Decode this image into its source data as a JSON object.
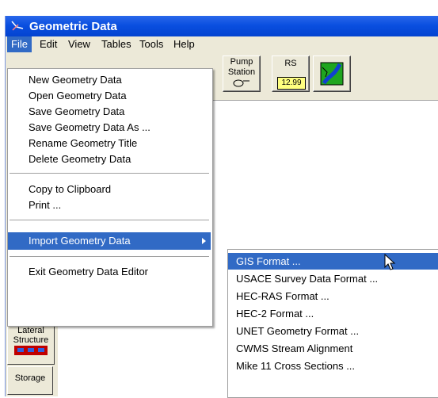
{
  "window": {
    "title": "Geometric Data"
  },
  "menubar": {
    "items": [
      "File",
      "Edit",
      "View",
      "Tables",
      "Tools",
      "Help"
    ]
  },
  "toolbar": {
    "pump_station_label_1": "Pump",
    "pump_station_label_2": "Station",
    "rs_label": "RS",
    "rs_value": "12.99"
  },
  "sidebar": {
    "lateral_structure_label_1": "Lateral",
    "lateral_structure_label_2": "Structure",
    "storage_label": "Storage"
  },
  "file_menu": {
    "new_geometry": "New Geometry Data",
    "open_geometry": "Open Geometry Data",
    "save_geometry": "Save Geometry Data",
    "save_geometry_as": "Save Geometry Data As ...",
    "rename_title": "Rename Geometry Title",
    "delete_geometry": "Delete Geometry Data",
    "copy_clipboard": "Copy to Clipboard",
    "print": "Print ...",
    "import_geometry": "Import Geometry Data",
    "exit_editor": "Exit Geometry Data Editor"
  },
  "import_submenu": {
    "gis_format": "GIS Format ...",
    "usace_survey": "USACE Survey Data Format ...",
    "hecras_format": "HEC-RAS Format ...",
    "hec2_format": "HEC-2 Format ...",
    "unet_format": "UNET Geometry Format ...",
    "cwms_stream": "CWMS Stream Alignment",
    "mike11": "Mike 11 Cross Sections ..."
  },
  "colors": {
    "titlebar": "#0a4fe0",
    "highlight": "#316ac5",
    "menubar": "#ece9d8"
  }
}
